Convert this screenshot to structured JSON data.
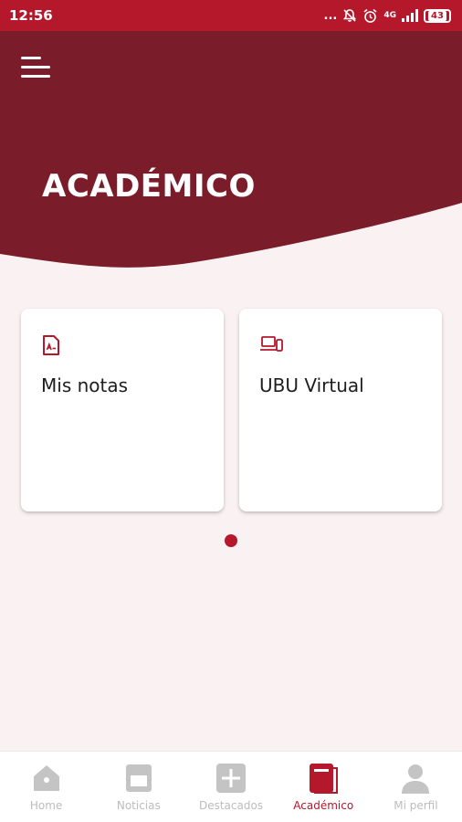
{
  "status_bar": {
    "time": "12:56",
    "dots": "...",
    "network": "4G",
    "battery": "43"
  },
  "header": {
    "title": "ACADÉMICO",
    "menu_icon": "hamburger-menu-icon"
  },
  "cards": [
    {
      "label": "Mis notas",
      "icon": "document-grade-icon"
    },
    {
      "label": "UBU Virtual",
      "icon": "laptop-phone-icon"
    }
  ],
  "bottom_nav": {
    "items": [
      {
        "label": "Home",
        "icon": "home-icon",
        "active": false
      },
      {
        "label": "Noticias",
        "icon": "news-icon",
        "active": false
      },
      {
        "label": "Destacados",
        "icon": "plus-icon",
        "active": false
      },
      {
        "label": "Académico",
        "icon": "book-icon",
        "active": true
      },
      {
        "label": "Mi perfil",
        "icon": "user-icon",
        "active": false
      }
    ]
  },
  "colors": {
    "brand_dark": "#7b1c2a",
    "accent": "#b5172b",
    "background": "#faf1f2",
    "inactive": "#bcbcbc"
  }
}
